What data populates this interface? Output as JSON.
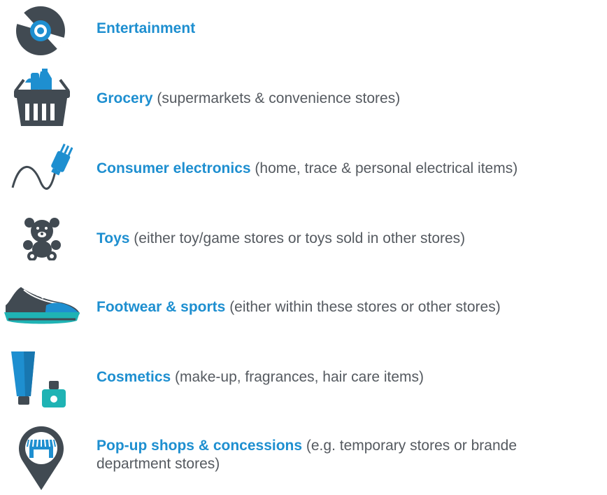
{
  "colors": {
    "accent_blue": "#1e8fd0",
    "icon_dark": "#414a52",
    "teal": "#1fb3b4",
    "text_gray": "#555a60"
  },
  "categories": [
    {
      "icon": "vinyl-disc-icon",
      "title": "Entertainment",
      "description": ""
    },
    {
      "icon": "grocery-basket-icon",
      "title": "Grocery",
      "description": " (supermarkets & convenience stores)"
    },
    {
      "icon": "power-plug-icon",
      "title": "Consumer electronics",
      "description": " (home, trace & personal electrical items)"
    },
    {
      "icon": "teddy-bear-icon",
      "title": "Toys",
      "description": " (either toy/game stores or toys sold in other stores)"
    },
    {
      "icon": "sneaker-icon",
      "title": "Footwear & sports",
      "description": " (either within these stores or other stores)"
    },
    {
      "icon": "cosmetics-icon",
      "title": "Cosmetics",
      "description": " (make-up, fragrances, hair care items)"
    },
    {
      "icon": "popup-shop-pin-icon",
      "title": "Pop-up shops & concessions",
      "description": " (e.g. temporary stores or brande",
      "description_line2": "department stores)"
    }
  ]
}
